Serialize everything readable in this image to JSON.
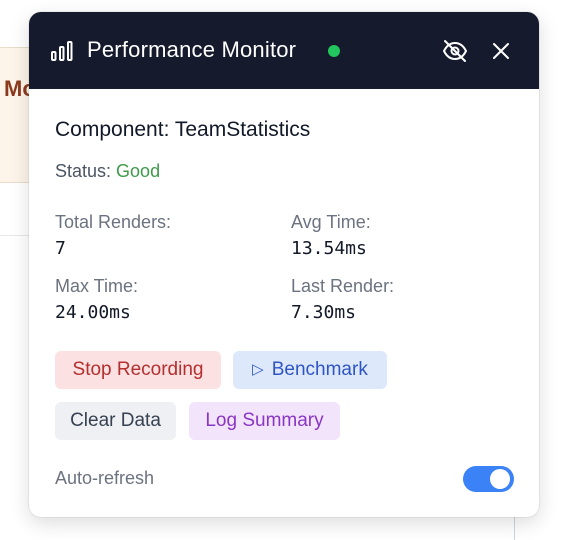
{
  "background": {
    "card_text": "Mo"
  },
  "monitor": {
    "title": "Performance Monitor",
    "status_dot_color": "#22c55e",
    "icons": {
      "chart": "bar-chart-icon",
      "visibility": "eye-off-icon",
      "close": "close-icon"
    },
    "component_label": "Component: TeamStatistics",
    "status_label": "Status:",
    "status_value": "Good",
    "metrics": {
      "total_renders_label": "Total Renders:",
      "total_renders_value": "7",
      "avg_time_label": "Avg Time:",
      "avg_time_value": "13.54ms",
      "max_time_label": "Max Time:",
      "max_time_value": "24.00ms",
      "last_render_label": "Last Render:",
      "last_render_value": "7.30ms"
    },
    "buttons": {
      "stop_recording": "Stop Recording",
      "benchmark_icon": "▷",
      "benchmark": "Benchmark",
      "clear_data": "Clear Data",
      "log_summary": "Log Summary"
    },
    "auto_refresh_label": "Auto-refresh",
    "auto_refresh_enabled": true
  }
}
